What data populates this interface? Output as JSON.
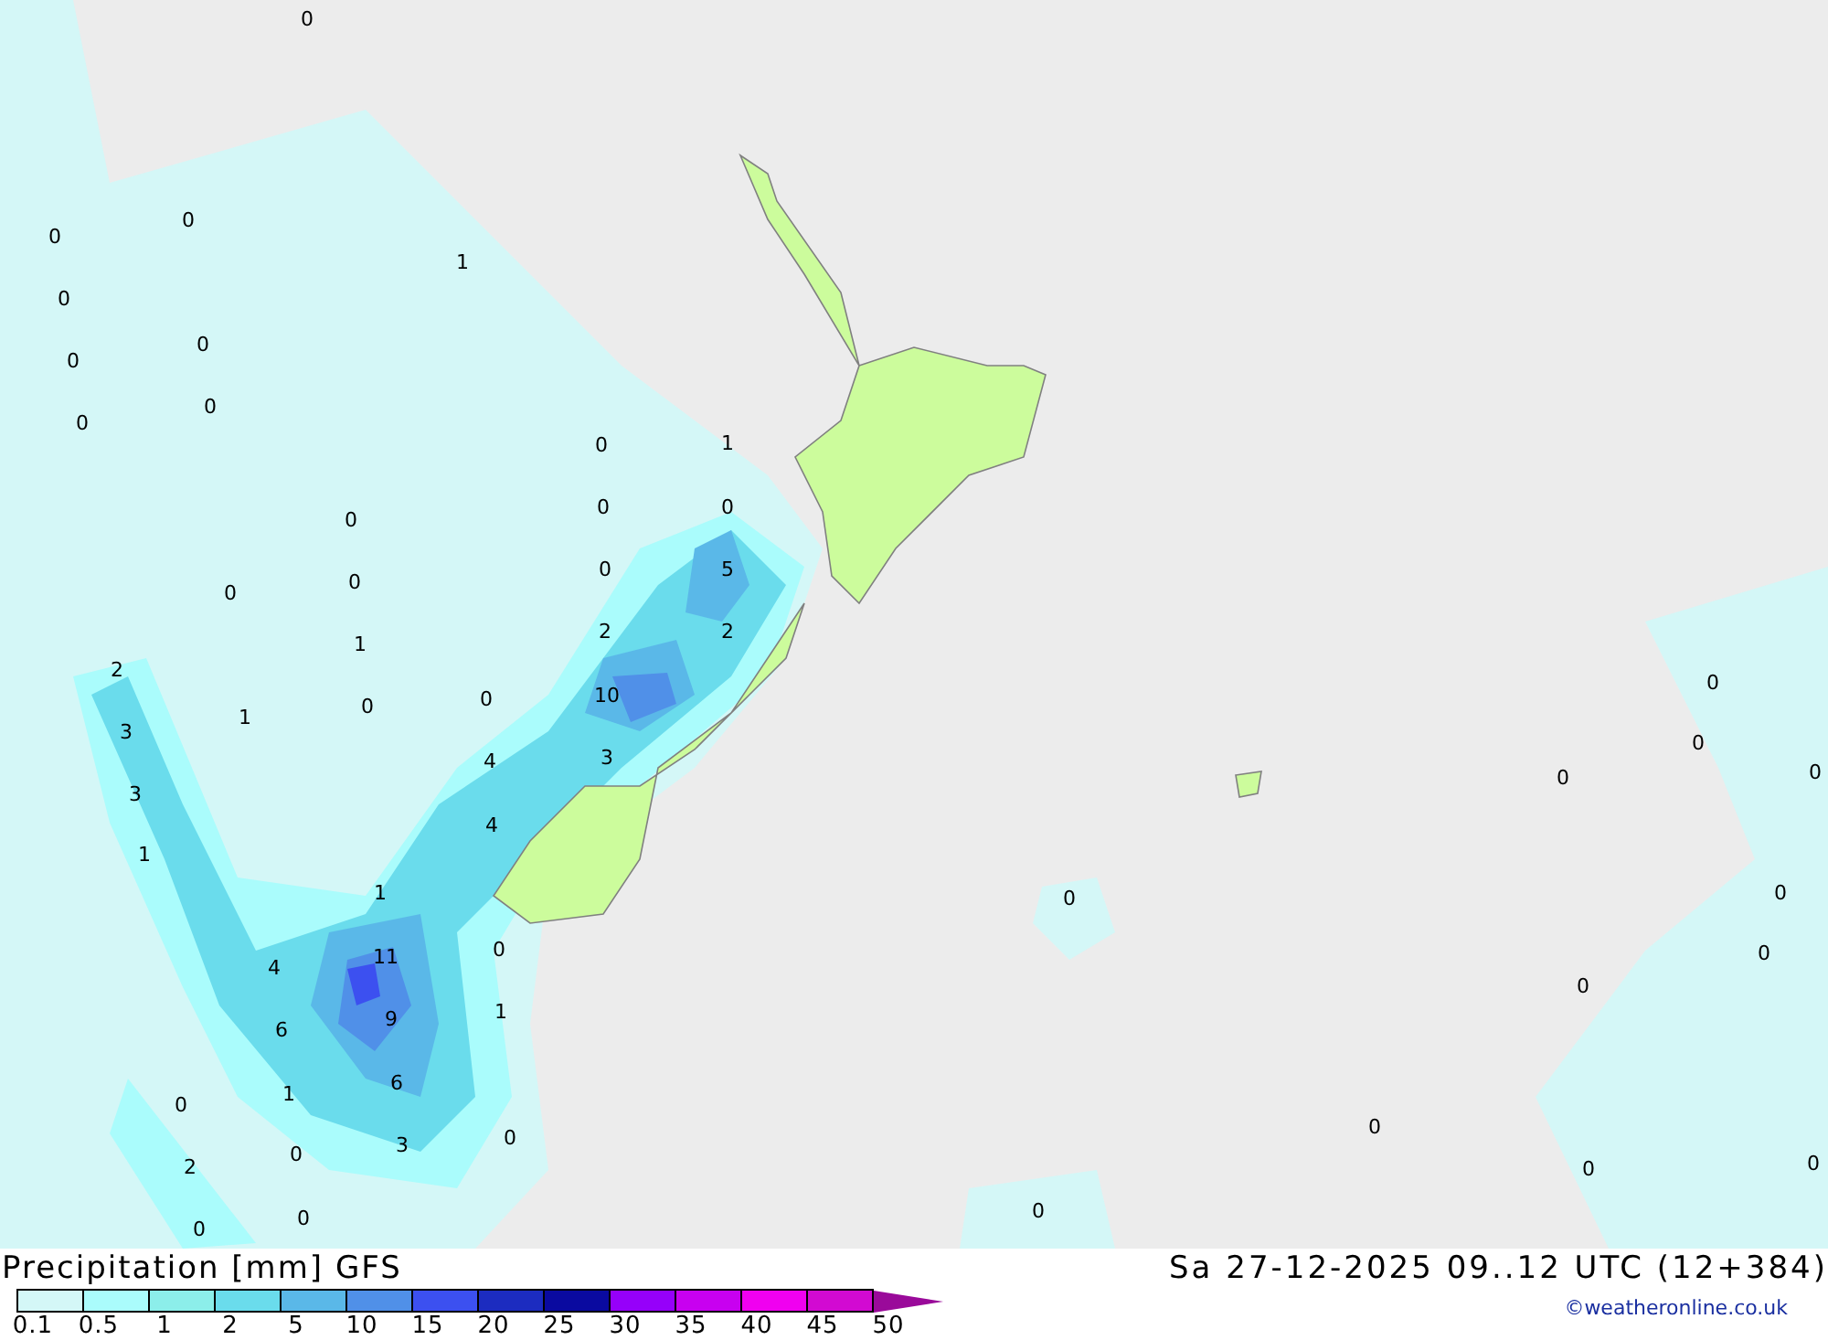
{
  "map": {
    "labels": [
      "0",
      "0",
      "0",
      "1",
      "0",
      "0",
      "0",
      "0",
      "0",
      "0",
      "1",
      "0",
      "0",
      "0",
      "0",
      "0",
      "0",
      "5",
      "1",
      "2",
      "2",
      "2",
      "1",
      "0",
      "0",
      "10",
      "0",
      "3",
      "0",
      "4",
      "3",
      "0",
      "0",
      "3",
      "4",
      "1",
      "1",
      "0",
      "0",
      "4",
      "11",
      "0",
      "0",
      "0",
      "6",
      "9",
      "1",
      "0",
      "1",
      "6",
      "2",
      "0",
      "3",
      "0",
      "0",
      "0",
      "0",
      "0",
      "0",
      "0"
    ]
  },
  "legend": {
    "title": "Precipitation [mm] GFS",
    "bins": [
      {
        "color": "#d4f7f7"
      },
      {
        "color": "#aafcfc"
      },
      {
        "color": "#8ceeea"
      },
      {
        "color": "#6adcec"
      },
      {
        "color": "#5ab8e8"
      },
      {
        "color": "#5090e8"
      },
      {
        "color": "#3c50f0"
      },
      {
        "color": "#1c2cc0"
      },
      {
        "color": "#0a0aa0"
      },
      {
        "color": "#9600fa"
      },
      {
        "color": "#c800f0"
      },
      {
        "color": "#f000f0"
      },
      {
        "color": "#d20ad2"
      }
    ],
    "ticks": [
      "0.1",
      "0.5",
      "1",
      "2",
      "5",
      "10",
      "15",
      "20",
      "25",
      "30",
      "35",
      "40",
      "45",
      "50"
    ]
  },
  "valid_time": "Sa 27-12-2025 09..12 UTC (12+384)",
  "credit": "©weatheronline.co.uk"
}
